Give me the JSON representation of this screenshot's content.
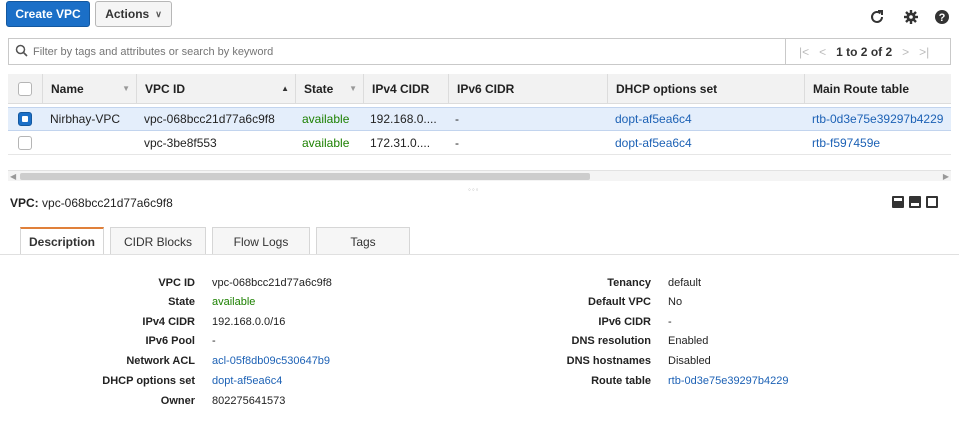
{
  "toolbar": {
    "create_label": "Create VPC",
    "actions_label": "Actions",
    "icons": [
      "refresh-icon",
      "gear-icon",
      "help-icon"
    ]
  },
  "search": {
    "placeholder": "Filter by tags and attributes or search by keyword",
    "pagination": "1 to 2 of 2"
  },
  "table": {
    "headers": [
      "Name",
      "VPC ID",
      "State",
      "IPv4 CIDR",
      "IPv6 CIDR",
      "DHCP options set",
      "Main Route table"
    ],
    "rows": [
      {
        "selected": true,
        "name": "Nirbhay-VPC",
        "vpc_id": "vpc-068bcc21d77a6c9f8",
        "state": "available",
        "ipv4": "192.168.0....",
        "ipv6": "-",
        "dhcp": "dopt-af5ea6c4",
        "route": "rtb-0d3e75e39297b4229"
      },
      {
        "selected": false,
        "name": "",
        "vpc_id": "vpc-3be8f553",
        "state": "available",
        "ipv4": "172.31.0....",
        "ipv6": "-",
        "dhcp": "dopt-af5ea6c4",
        "route": "rtb-f597459e"
      }
    ]
  },
  "detail": {
    "title_label": "VPC:",
    "title_value": "vpc-068bcc21d77a6c9f8",
    "tabs": [
      "Description",
      "CIDR Blocks",
      "Flow Logs",
      "Tags"
    ],
    "left": [
      {
        "k": "VPC ID",
        "v": "vpc-068bcc21d77a6c9f8"
      },
      {
        "k": "State",
        "v": "available"
      },
      {
        "k": "IPv4 CIDR",
        "v": "192.168.0.0/16"
      },
      {
        "k": "IPv6 Pool",
        "v": "-"
      },
      {
        "k": "Network ACL",
        "v": "acl-05f8db09c530647b9"
      },
      {
        "k": "DHCP options set",
        "v": "dopt-af5ea6c4"
      },
      {
        "k": "Owner",
        "v": "802275641573"
      }
    ],
    "right": [
      {
        "k": "Tenancy",
        "v": "default"
      },
      {
        "k": "Default VPC",
        "v": "No"
      },
      {
        "k": "IPv6 CIDR",
        "v": "-"
      },
      {
        "k": "DNS resolution",
        "v": "Enabled"
      },
      {
        "k": "DNS hostnames",
        "v": "Disabled"
      },
      {
        "k": "Route table",
        "v": "rtb-0d3e75e39297b4229"
      }
    ]
  },
  "colors": {
    "primary": "#1b6fc7",
    "link": "#1c61b5",
    "available": "#1d8102",
    "selected_row": "#e4eefb",
    "active_tab": "#e0803a"
  }
}
